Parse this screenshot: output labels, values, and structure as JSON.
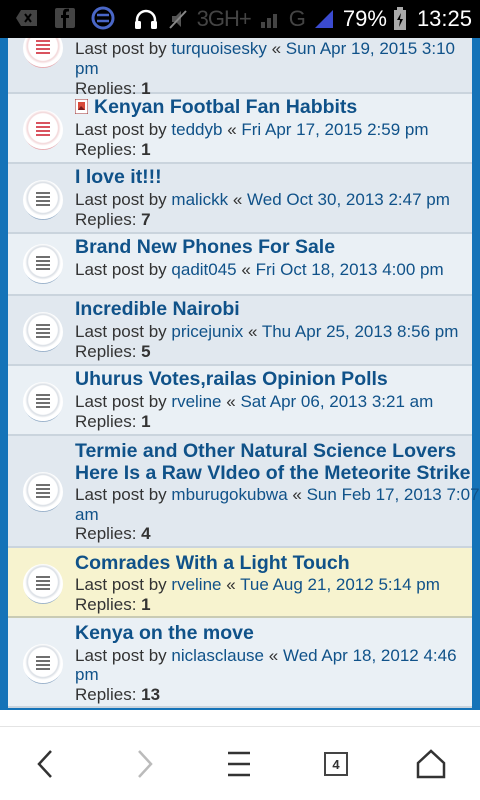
{
  "status_bar": {
    "network": "3GH+",
    "network2": "G",
    "battery_percent": "79%",
    "time": "13:25",
    "icons": [
      "back-icon",
      "facebook-icon",
      "sync-icon",
      "headphones-icon",
      "no-sound-icon",
      "signal-icon",
      "battery-icon"
    ]
  },
  "labels": {
    "last_post_by": "Last post by",
    "replies": "Replies:",
    "sep": "«"
  },
  "topics": [
    {
      "title": "",
      "author": "turquoisesky",
      "date": "Sun Apr 19, 2015 3:10",
      "date2": "pm",
      "replies": "1",
      "icon": "hot"
    },
    {
      "title": "Kenyan Footbal Fan Habbits",
      "author": "teddyb",
      "date": "Fri Apr 17, 2015 2:59 pm",
      "replies": "1",
      "icon": "hot",
      "attachment": true
    },
    {
      "title": "I love it!!!",
      "author": "malickk",
      "date": "Wed Oct 30, 2013 2:47 pm",
      "replies": "7",
      "icon": "read"
    },
    {
      "title": "Brand New Phones For Sale",
      "author": "qadit045",
      "date": "Fri Oct 18, 2013 4:00 pm",
      "icon": "read"
    },
    {
      "title": "Incredible Nairobi",
      "author": "pricejunix",
      "date": "Thu Apr 25, 2013 8:56 pm",
      "replies": "5",
      "icon": "read"
    },
    {
      "title": "Uhurus Votes,railas Opinion Polls",
      "author": "rveline",
      "date": "Sat Apr 06, 2013 3:21 am",
      "replies": "1",
      "icon": "read"
    },
    {
      "title": "Termie and Other Natural Science Lovers",
      "title2": "Here Is a Raw VIdeo of the Meteorite Strike",
      "author": "mburugokubwa",
      "date": "Sun Feb 17, 2013 7:07",
      "date2": "am",
      "replies": "4",
      "icon": "read"
    },
    {
      "title": "Comrades With a Light Touch",
      "author": "rveline",
      "date": "Tue Aug 21, 2012 5:14 pm",
      "replies": "1",
      "icon": "read",
      "sticky": true
    },
    {
      "title": "Kenya on the move",
      "author": "niclasclause",
      "date": "Wed Apr 18, 2012 4:46",
      "date2": "pm",
      "replies": "13",
      "icon": "read"
    }
  ],
  "nav": {
    "tab_count": "4",
    "icons": [
      "back-arrow-icon",
      "forward-arrow-icon",
      "menu-icon",
      "tabs-icon",
      "home-icon"
    ]
  },
  "colors": {
    "forum_blue": "#1573b8",
    "link_blue": "#105289",
    "sticky_bg": "#f7f3cf"
  }
}
